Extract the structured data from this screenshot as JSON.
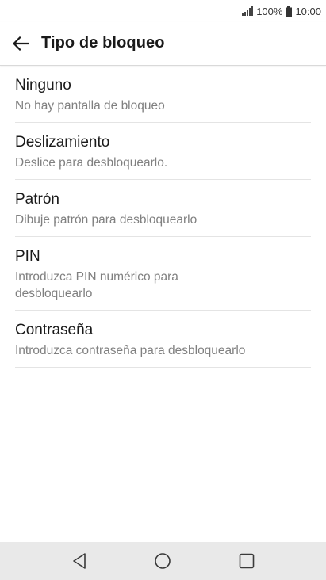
{
  "status_bar": {
    "battery_percent": "100%",
    "time": "10:00",
    "icons": [
      "signal-icon",
      "battery-icon"
    ]
  },
  "header": {
    "title": "Tipo de bloqueo",
    "back_icon": "arrow-left-icon"
  },
  "lock_types": [
    {
      "title": "Ninguno",
      "subtitle": "No hay pantalla de bloqueo"
    },
    {
      "title": "Deslizamiento",
      "subtitle": "Deslice para desbloquearlo."
    },
    {
      "title": "Patrón",
      "subtitle": "Dibuje patrón para desbloquearlo"
    },
    {
      "title": "PIN",
      "subtitle": "Introduzca PIN numérico para desbloquearlo"
    },
    {
      "title": "Contraseña",
      "subtitle": "Introduzca contraseña para desbloquearlo"
    }
  ],
  "nav_bar": {
    "icons": [
      "back-triangle-icon",
      "home-circle-icon",
      "recents-square-icon"
    ]
  },
  "colors": {
    "background": "#ffffff",
    "title_text": "#1a1a1a",
    "subtitle_text": "#808080",
    "divider": "#e4e4e4",
    "nav_bar": "#e9e9e9"
  }
}
